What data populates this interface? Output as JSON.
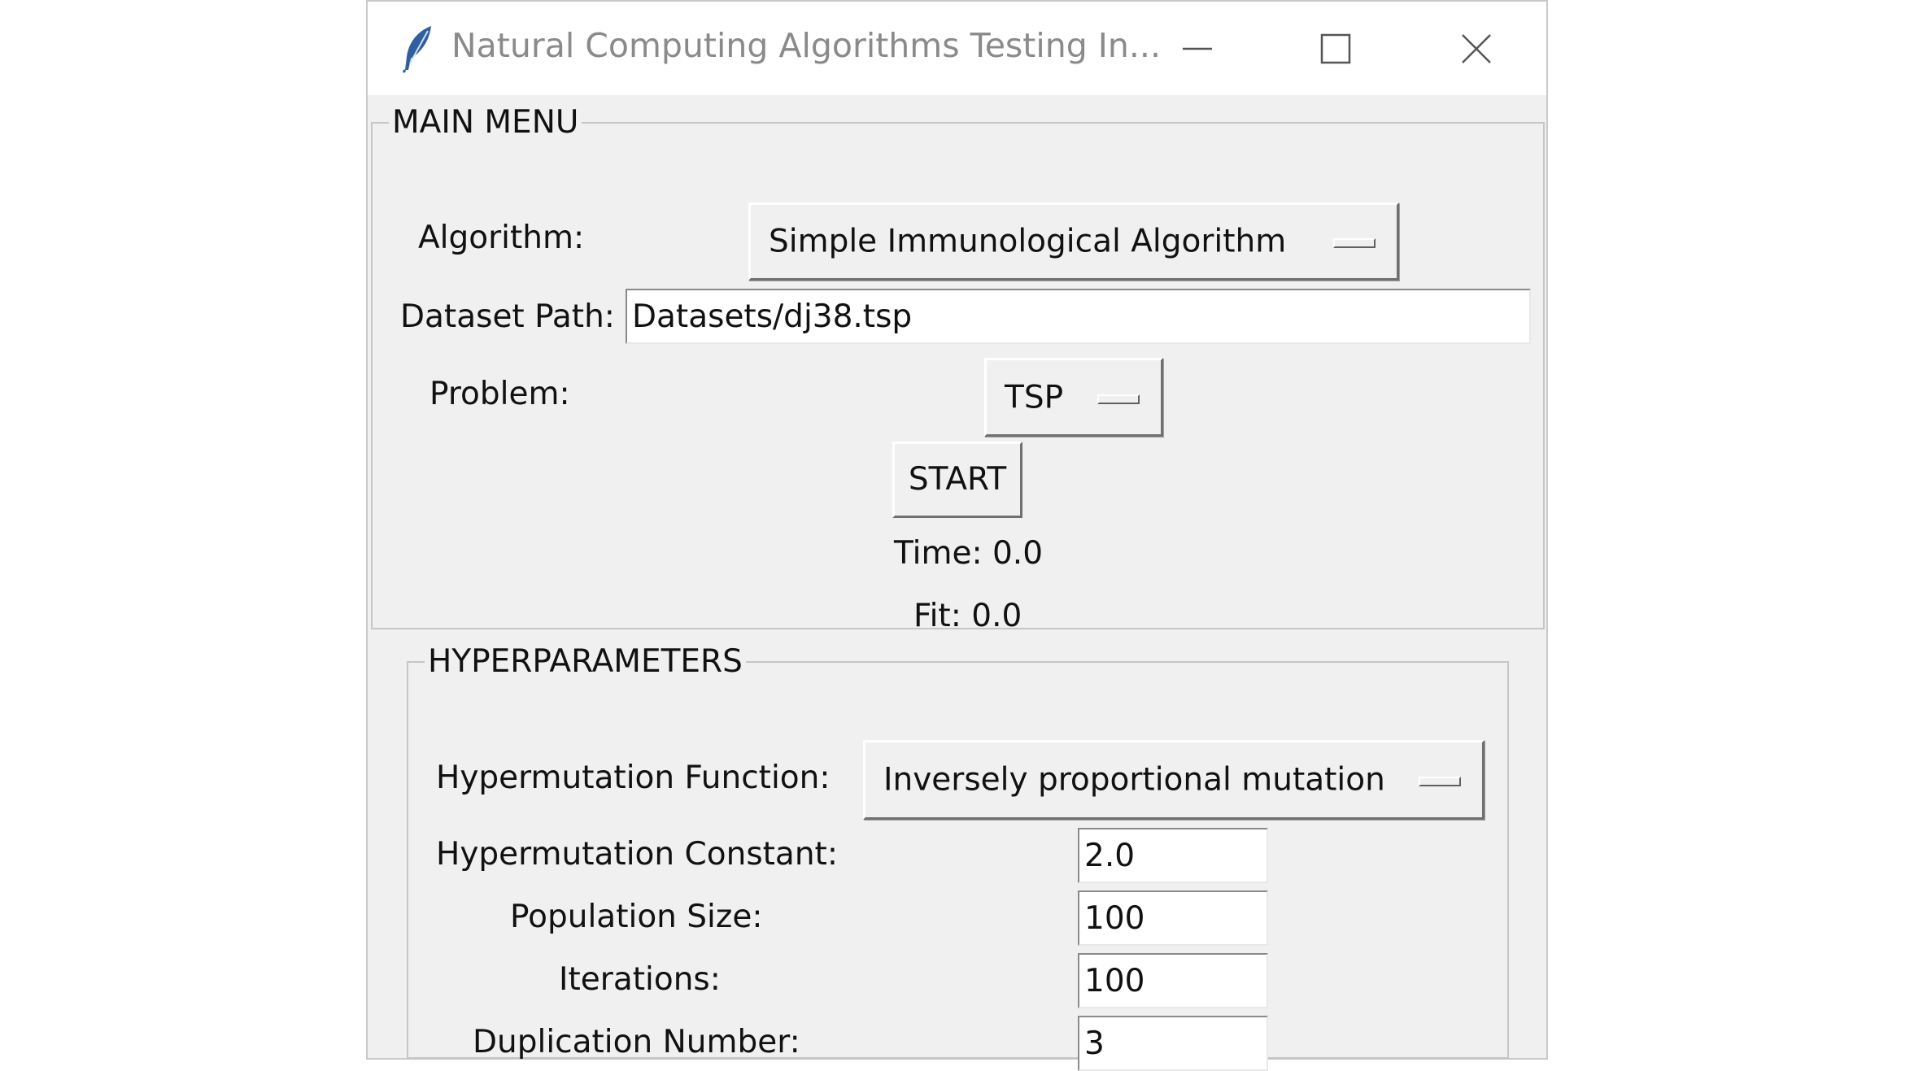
{
  "window": {
    "title": "Natural Computing Algorithms Testing In...",
    "icon": "feather-icon",
    "controls": [
      "minimize-icon",
      "maximize-icon",
      "close-icon"
    ]
  },
  "main_menu": {
    "legend": "MAIN MENU",
    "algorithm_label": "Algorithm:",
    "algorithm_value": "Simple Immunological Algorithm",
    "dataset_label": "Dataset Path:",
    "dataset_value": "Datasets/dj38.tsp",
    "problem_label": "Problem:",
    "problem_value": "TSP",
    "start_label": "START",
    "time_text": "Time: 0.0",
    "fit_text": "Fit: 0.0"
  },
  "hyperparameters": {
    "legend": "HYPERPARAMETERS",
    "hypermutation_function_label": "Hypermutation Function:",
    "hypermutation_function_value": "Inversely proportional mutation",
    "hypermutation_constant_label": "Hypermutation Constant:",
    "hypermutation_constant_value": "2.0",
    "population_size_label": "Population Size:",
    "population_size_value": "100",
    "iterations_label": "Iterations:",
    "iterations_value": "100",
    "duplication_number_label": "Duplication Number:",
    "duplication_number_value": "3"
  },
  "colors": {
    "window_bg": "#f0f0f0",
    "titlebar_bg": "#ffffff",
    "title_text": "#8a8a8a",
    "border": "#c6c6c6",
    "icon_blue": "#2f5f9e"
  }
}
